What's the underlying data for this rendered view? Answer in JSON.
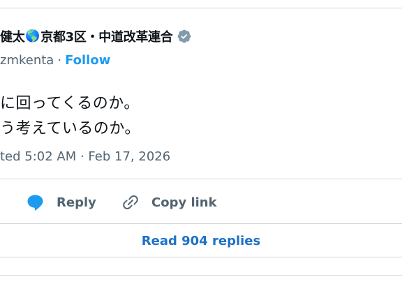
{
  "tweet": {
    "display_name_part1": "健太",
    "display_name_part2": "京都3区・中道改革連合",
    "name_emoji": "🌎",
    "handle": "zmkenta",
    "handle_separator": "·",
    "follow_label": "Follow",
    "text_line1": "に回ってくるのか。",
    "text_line2": "う考えているのか。",
    "meta": "ted 5:02 AM · Feb 17, 2026"
  },
  "actions": {
    "reply_label": "Reply",
    "copy_link_label": "Copy link"
  },
  "read_replies_label": "Read 904 replies",
  "colors": {
    "accent": "#1d9bf0",
    "link": "#1d72c6",
    "muted": "#536471",
    "border": "#cfd9de",
    "verified_badge": "#829aab"
  },
  "icons": {
    "verified": "verified-badge-icon",
    "reply": "speech-bubble-icon",
    "copy_link": "link-icon"
  }
}
